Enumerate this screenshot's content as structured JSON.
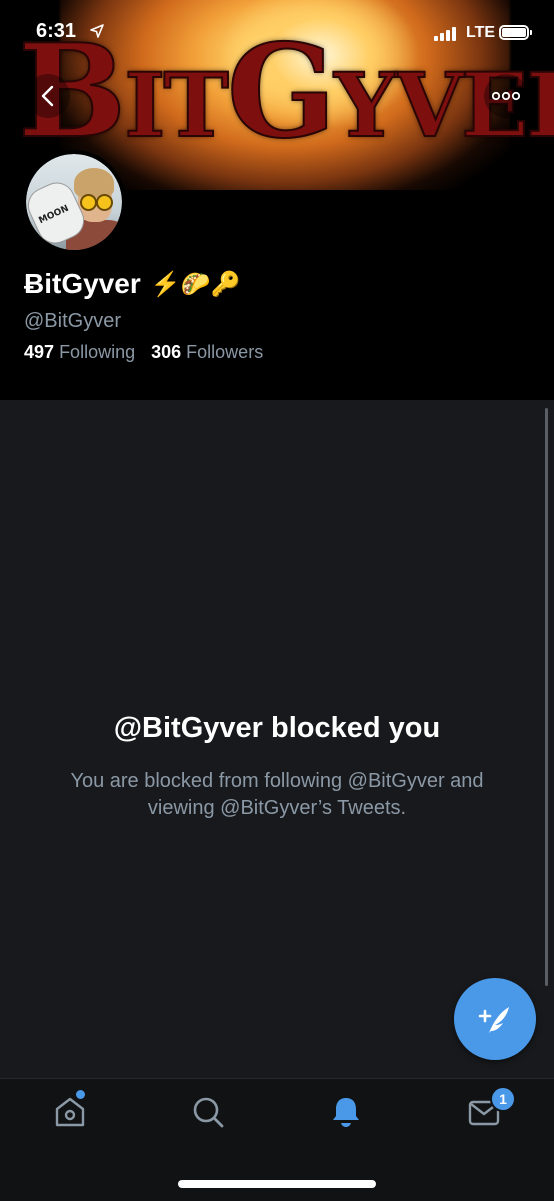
{
  "status": {
    "time": "6:31",
    "network": "LTE"
  },
  "banner": {
    "title_first": "B",
    "title_rest1": "IT",
    "title_mid": "G",
    "title_rest2": "YVER",
    "avatar_can_text": "MOON"
  },
  "profile": {
    "display_name": "ɃitGyver",
    "emojis": "⚡🌮🔑",
    "handle": "@BitGyver",
    "following_count": "497",
    "following_label": "Following",
    "followers_count": "306",
    "followers_label": "Followers"
  },
  "blocked": {
    "title": "@BitGyver blocked you",
    "message": "You are blocked from following @BitGyver and viewing @BitGyver’s Tweets."
  },
  "tabbar": {
    "messages_badge": "1"
  },
  "icons": {
    "back": "chevron-left-icon",
    "more": "more-options-icon",
    "compose": "compose-tweet-icon",
    "home": "home-icon",
    "search": "search-icon",
    "notifications": "bell-icon",
    "messages": "envelope-icon"
  },
  "colors": {
    "accent": "#4a99e9",
    "panel_bg": "#17191c",
    "secondary_text": "#8b98a5"
  }
}
